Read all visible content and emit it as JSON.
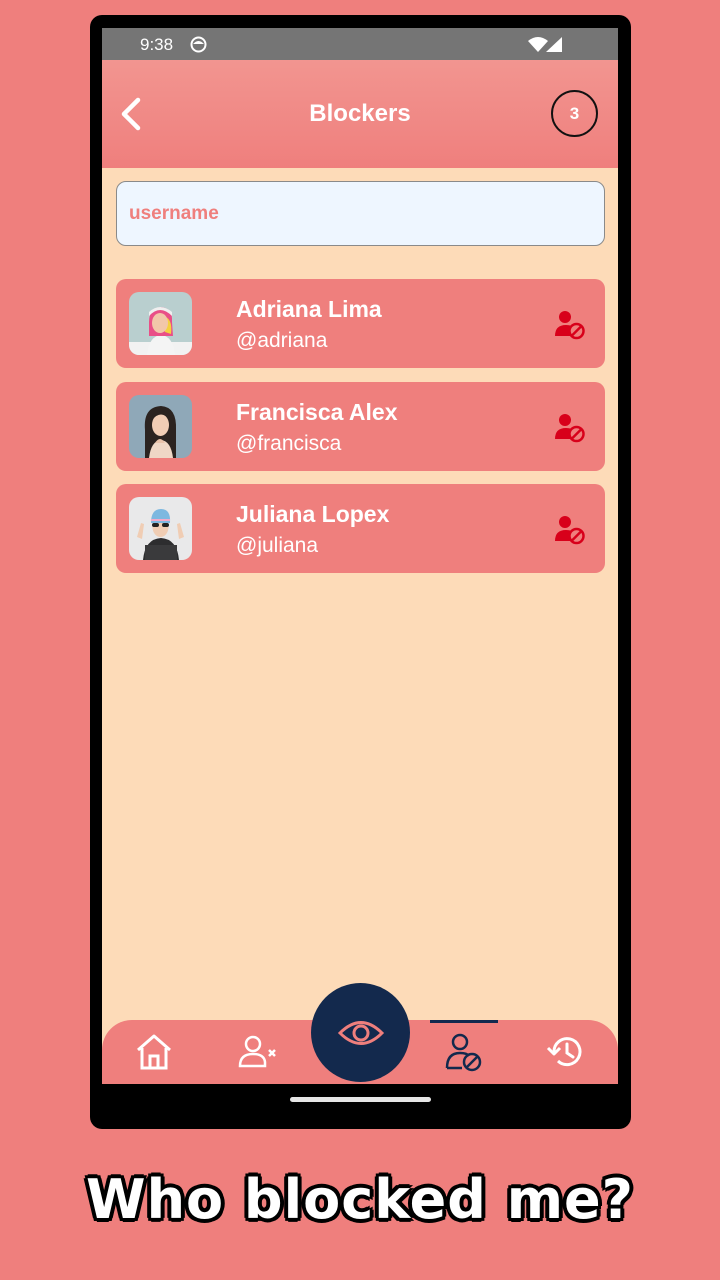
{
  "status_bar": {
    "time": "9:38"
  },
  "header": {
    "title": "Blockers",
    "count": "3"
  },
  "search": {
    "placeholder": "username",
    "value": ""
  },
  "blockers": [
    {
      "name": "Adriana Lima",
      "handle": "@adriana"
    },
    {
      "name": "Francisca Alex",
      "handle": "@francisca"
    },
    {
      "name": "Juliana Lopex",
      "handle": "@juliana"
    }
  ],
  "bottom_nav": {
    "items": [
      "home-icon",
      "remove-user-icon",
      "eye-icon",
      "blocked-user-icon",
      "history-icon"
    ],
    "active": "blocked-user-icon"
  },
  "caption": "Who blocked me?",
  "colors": {
    "background": "#ef7f7d",
    "screen": "#fddbb8",
    "accent_dark": "#13294d",
    "block_icon": "#d8001a"
  }
}
